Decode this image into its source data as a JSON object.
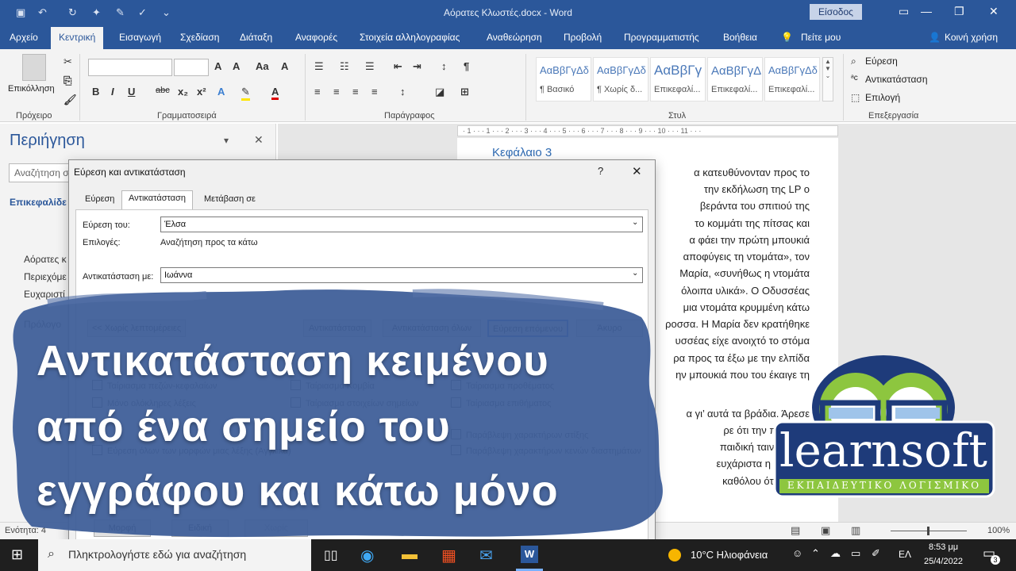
{
  "window": {
    "title": "Αόρατες Κλωστές.docx  -  Word",
    "signin": "Είσοδος"
  },
  "tabs": [
    "Αρχείο",
    "Κεντρική",
    "Εισαγωγή",
    "Σχεδίαση",
    "Διάταξη",
    "Αναφορές",
    "Στοιχεία αλληλογραφίας",
    "Αναθεώρηση",
    "Προβολή",
    "Προγραμματιστής",
    "Βοήθεια",
    "Πείτε μου"
  ],
  "share": "Κοινή χρήση",
  "ribbon": {
    "paste": "Επικόλληση",
    "groups": [
      "Πρόχειρο",
      "Γραμματοσειρά",
      "Παράγραφος",
      "Στυλ",
      "Επεξεργασία"
    ],
    "styles": [
      {
        "sample": "ΑαΒβΓγΔδ",
        "name": "¶ Βασικό"
      },
      {
        "sample": "ΑαΒβΓγΔδ",
        "name": "¶ Χωρίς δ..."
      },
      {
        "sample": "ΑαΒβΓγ",
        "name": "Επικεφαλί..."
      },
      {
        "sample": "ΑαΒβΓγΔ",
        "name": "Επικεφαλί..."
      },
      {
        "sample": "ΑαΒβΓγΔδ",
        "name": "Επικεφαλί..."
      }
    ],
    "editing": [
      "Εύρεση",
      "Αντικατάσταση",
      "Επιλογή"
    ]
  },
  "nav": {
    "title": "Περιήγηση",
    "search_placeholder": "Αναζήτηση σ",
    "tab_headings": "Επικεφαλίδε",
    "items": [
      "Αόρατες κ",
      "Περιεχόμε",
      "Ευχαριστί",
      "Πρόλογο"
    ]
  },
  "document": {
    "chapter": "Κεφάλαιο 3",
    "lines": [
      "α κατευθύνονταν προς το",
      "την εκδήλωση της LP ο",
      "βεράντα του σπιτιού της",
      "το κομμάτι της πίτσας και",
      "α φάει την πρώτη μπουκιά",
      "αποφύγεις τη ντομάτα», τον",
      "Μαρία, «συνήθως η ντομάτα",
      "όλοιπα υλικά». Ο Οδυσσέας",
      "μια ντομάτα κρυμμένη κάτω",
      "ροσσα. Η Μαρία δεν κρατήθηκε",
      "υσσέας είχε ανοιχτό το στόμα",
      "ρα προς τα έξω με την ελπίδα",
      "ην μπουκιά που του έκαιγε τη",
      "",
      "α γι’ αυτά τα βράδια. Άρεσε",
      "ρε ότι την περιμένε",
      "παιδική ταινία ή ένα",
      "ευχάριστα η ώρα και",
      "καθόλου όταν έπρε"
    ]
  },
  "status": {
    "page": "Ενότητα: 4",
    "zoom": "100%"
  },
  "dialog": {
    "title": "Εύρεση και αντικατάσταση",
    "help": "?",
    "tabs": [
      "Εύρεση",
      "Αντικατάσταση",
      "Μετάβαση σε"
    ],
    "find_label": "Εύρεση του:",
    "find_value": "Έλσα",
    "options_label": "Επιλογές:",
    "options_value": "Αναζήτηση προς τα κάτω",
    "replace_label": "Αντικατάσταση με:",
    "replace_value": "Ιωάννα",
    "buttons": [
      "<< Χωρίς λεπτομέρειες",
      "Αντικατάσταση",
      "Αντικατάσταση όλων",
      "Εύρεση επόμενου",
      "Άκυρο"
    ],
    "checks": [
      "Ταίριασμα πεζών-κεφαλαίων",
      "Μόνο ολόκληρες λέξεις",
      "Ταίριασμα Κομβία",
      "Ταίριασμα στοιχείων σημείων",
      "Ταίριασμα προθέματος",
      "Ταίριασμα επιθήματος",
      "Παράβλεψη χαρακτήρων στίξης",
      "Εύρεση όλων των μορφών μιας λέξης (Αγγλικά)",
      "Παράβλεψη χαρακτήρων κενών διαστημάτων"
    ],
    "bottom_buttons": [
      "Μορφή",
      "Ειδική",
      "Χωρίς μορφοποίηση"
    ]
  },
  "caption": [
    "Αντικατάσταση κειμένου",
    "από ένα σημείο του",
    "εγγράφου και κάτω μόνο"
  ],
  "logo": {
    "name": "learnsoft",
    "tagline": "ΕΚΠΑΙΔΕΥΤΙΚΟ ΛΟΓΙΣΜΙΚΟ"
  },
  "taskbar": {
    "search_placeholder": "Πληκτρολογήστε εδώ για αναζήτηση",
    "weather": "10°C  Ηλιοφάνεια",
    "lang": "ΕΛ",
    "time": "8:53 μμ",
    "date": "25/4/2022",
    "notifications": "3"
  },
  "colors": {
    "word_blue": "#2b579a",
    "caption_blob": "#3f5f99",
    "logo_green": "#8dc63f",
    "logo_navy": "#1e3b7a"
  }
}
